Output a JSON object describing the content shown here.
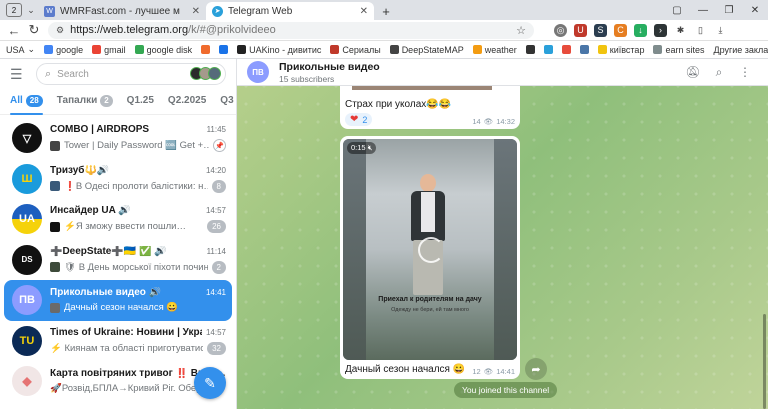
{
  "browser": {
    "tab_count": "2",
    "tabs": [
      {
        "title": "WMRFast.com - лучшее м",
        "active": false,
        "fav_color": "#5c7ccc",
        "fav_letter": "W"
      },
      {
        "title": "Telegram Web",
        "active": true,
        "fav_color": "#2aa0da",
        "fav_letter": "✈"
      }
    ],
    "url_host": "https://web.telegram.org",
    "url_path": "/k/#@prikolvideeo",
    "bookmarks": [
      {
        "label": "USA",
        "icon_color": "",
        "has_caret": true
      },
      {
        "label": "google",
        "icon_color": "#4285f4"
      },
      {
        "label": "gmail",
        "icon_color": "#ea4335"
      },
      {
        "label": "google disk",
        "icon_color": "#34a853"
      },
      {
        "label": "",
        "icon_color": "#f06b2d"
      },
      {
        "label": "",
        "icon_color": "#1a73e8"
      },
      {
        "label": "UAKino - дивитис",
        "icon_color": "#222222"
      },
      {
        "label": "Сериалы",
        "icon_color": "#c0392b"
      },
      {
        "label": "DeepStateMAP",
        "icon_color": "#444444"
      },
      {
        "label": "weather",
        "icon_color": "#f39c12"
      },
      {
        "label": "",
        "icon_color": "#333333"
      },
      {
        "label": "",
        "icon_color": "#2aa0da"
      },
      {
        "label": "",
        "icon_color": "#e74c3c"
      },
      {
        "label": "",
        "icon_color": "#4a76a8"
      },
      {
        "label": "київстар",
        "icon_color": "#f1c40f"
      },
      {
        "label": "earn sites",
        "icon_color": "#7f8c8d"
      }
    ],
    "bookmarks_more": "Другие закладки"
  },
  "sidebar": {
    "search_placeholder": "Search",
    "folders": [
      {
        "label": "All",
        "count": "28",
        "active": true
      },
      {
        "label": "Тапалки",
        "count": "2",
        "active": false
      },
      {
        "label": "Q1.25",
        "count": "",
        "active": false
      },
      {
        "label": "Q2.2025",
        "count": "",
        "active": false
      },
      {
        "label": "Q3",
        "count": "",
        "active": false
      }
    ],
    "chats": [
      {
        "name": "COMBO | AIRDROPS",
        "time": "11:45",
        "preview": "Tower | Daily Password 🆒 Get +…",
        "badge": "",
        "pinned": true,
        "avatar_color": "#111111",
        "avatar_text": "▽",
        "active": false
      },
      {
        "name": "Тризуб🔱🔊",
        "time": "14:20",
        "preview": "❗В Одесі пролоти балістики: н…",
        "badge": "8",
        "pinned": false,
        "avatar_color": "#1a9bdc",
        "avatar_text": "Ш",
        "active": false
      },
      {
        "name": "Инсайдер UA 🔊",
        "time": "14:57",
        "preview": "⚡Я зможу ввести пошли…",
        "badge": "26",
        "pinned": false,
        "avatar_color": "#1d5fbf",
        "avatar_text": "UA",
        "active": false
      },
      {
        "name": "➕DeepState➕🇺🇦 ✅ 🔊",
        "time": "11:14",
        "preview": "🛡 В День морської піхоти почин…",
        "badge": "2",
        "pinned": false,
        "avatar_color": "#111111",
        "avatar_text": "DS",
        "active": false
      },
      {
        "name": "Прикольные видео 🔊",
        "time": "14:41",
        "preview": "Дачный сезон начался 😀",
        "badge": "",
        "pinned": false,
        "avatar_color": "#8c9cff",
        "avatar_text": "ПВ",
        "active": true
      },
      {
        "name": "Times of Ukraine: Новини | Україна",
        "time": "14:57",
        "preview": "⚡ Киянам та області приготуватис…",
        "badge": "32",
        "pinned": false,
        "avatar_color": "#0b2a56",
        "avatar_text": "TU",
        "active": false
      },
      {
        "name": "Карта повітряних тривог ‼️ Вибу…",
        "time": "14:??",
        "preview": "🚀Розвід,БПЛА→Кривий Ріг. Обер…",
        "badge": "",
        "pinned": false,
        "avatar_color": "#e9e4e4",
        "avatar_text": "",
        "active": false
      }
    ]
  },
  "channel": {
    "avatar_text": "ПВ",
    "avatar_color": "#8c9cff",
    "title": "Прикольные видео",
    "subscribers": "15 subscribers"
  },
  "messages": [
    {
      "text": "Страх при уколах😂😂",
      "reaction_emoji": "❤️",
      "reaction_count": "2",
      "views": "14",
      "time": "14:32"
    },
    {
      "duration": "0:15",
      "caption_line1": "Приехал к родителям на дачу",
      "caption_line2": "Одежду не бери, ей там много",
      "text": "Дачный сезон начался 😀",
      "views": "12",
      "time": "14:41"
    }
  ],
  "service_message": "You joined this channel",
  "colors": {
    "accent": "#3390ec"
  }
}
